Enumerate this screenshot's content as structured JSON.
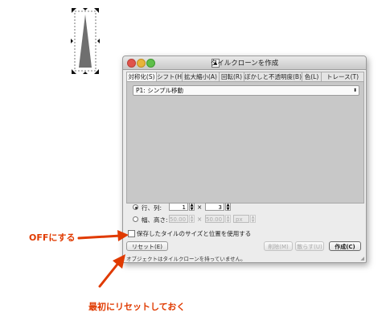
{
  "dialog": {
    "title": "タイルクローンを作成",
    "tabs": [
      "対称化(S)",
      "シフト(H)",
      "拡大縮小(A)",
      "回転(R)",
      "ぼかしと不透明度(B)",
      "色(L)",
      "トレース(T)"
    ],
    "symmetry_value": "P1: シンプル移動",
    "rows_cols": {
      "label": "行、列:",
      "rows": "1",
      "cols": "3",
      "times": "×"
    },
    "width_height": {
      "label": "幅、高さ:",
      "width": "50.00",
      "height": "50.00",
      "unit": "px",
      "times": "×"
    },
    "keep_size_label": "保存したタイルのサイズと位置を使用する",
    "buttons": {
      "reset": "リセット(E)",
      "delete": "削除(M)",
      "scatter": "散らす(U)",
      "create": "作成(C)"
    },
    "status": "オブジェクトはタイルクローンを持っていません。"
  },
  "annotations": {
    "off_label": "OFFにする",
    "reset_label": "最初にリセットしておく"
  },
  "colors": {
    "annotation": "#e03a00",
    "window_bg": "#ececec",
    "pane_bg": "#c8c8c8"
  }
}
